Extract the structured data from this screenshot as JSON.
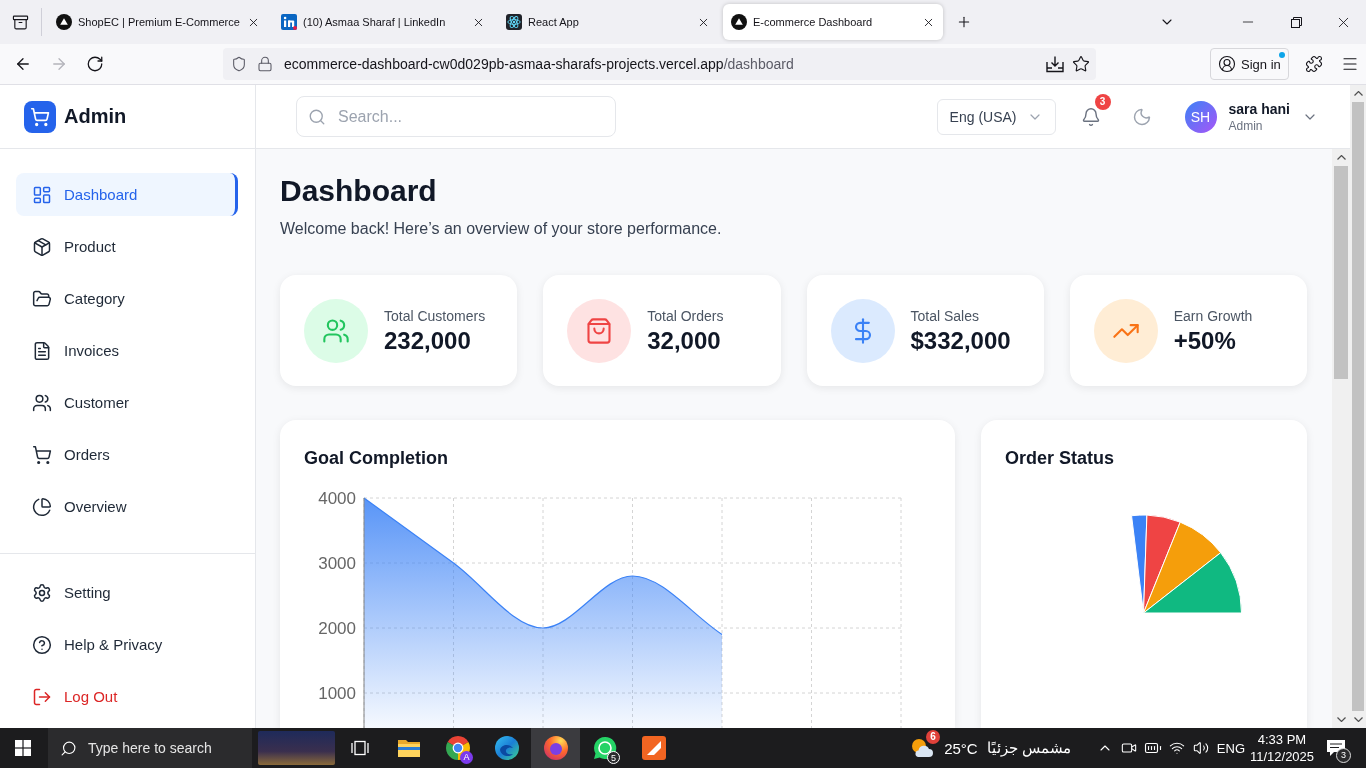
{
  "browser": {
    "tabs": [
      {
        "title": "ShopEC | Premium E-Commerce",
        "kind": "triangle",
        "selected": false
      },
      {
        "title": "(10) Asmaa Sharaf | LinkedIn",
        "kind": "blue-square",
        "selected": false
      },
      {
        "title": "React App",
        "kind": "atom",
        "selected": false
      },
      {
        "title": "E-commerce Dashboard",
        "kind": "triangle",
        "selected": true
      }
    ],
    "nav_buttons": [
      {
        "kind": "back",
        "disabled": false
      },
      {
        "kind": "forward",
        "disabled": true
      },
      {
        "kind": "reload",
        "disabled": false
      }
    ],
    "address": {
      "host": "ecommerce-dashboard-cw0d029pb-asmaa-sharafs-projects.vercel.app",
      "path": "/dashboard"
    },
    "sign_in": "Sign in"
  },
  "app": {
    "brand": "Admin",
    "search": {
      "placeholder": "Search..."
    },
    "language": "Eng (USA)",
    "notification_count": "3",
    "user": {
      "initials": "SH",
      "name": "sara hani",
      "role": "Admin"
    },
    "sidebar": {
      "items": [
        {
          "label": "Dashboard",
          "kind": "dashboard",
          "selected": true
        },
        {
          "label": "Product",
          "kind": "product",
          "selected": false
        },
        {
          "label": "Category",
          "kind": "category",
          "selected": false
        },
        {
          "label": "Invoices",
          "kind": "invoices",
          "selected": false
        },
        {
          "label": "Customer",
          "kind": "customer",
          "selected": false
        },
        {
          "label": "Orders",
          "kind": "orders",
          "selected": false
        },
        {
          "label": "Overview",
          "kind": "overview",
          "selected": false
        }
      ],
      "bottom_items": [
        {
          "label": "Setting",
          "kind": "settings",
          "selected": false
        },
        {
          "label": "Help & Privacy",
          "kind": "help",
          "selected": false
        },
        {
          "label": "Log Out",
          "kind": "logout",
          "selected": false
        }
      ]
    },
    "page": {
      "title": "Dashboard",
      "subtitle": "Welcome back! Here’s an overview of your store performance."
    },
    "stats": [
      {
        "label": "Total Customers",
        "value": "232,000",
        "kind": "customers"
      },
      {
        "label": "Total Orders",
        "value": "32,000",
        "kind": "orders"
      },
      {
        "label": "Total Sales",
        "value": "$332,000",
        "kind": "sales"
      },
      {
        "label": "Earn Growth",
        "value": "+50%",
        "kind": "growth"
      }
    ],
    "goal_completion": {
      "title": "Goal Completion",
      "chart_data": {
        "type": "area",
        "categories": [
          null,
          null,
          null,
          null,
          null,
          null,
          null
        ],
        "values": [
          4000,
          3000,
          2000,
          2800,
          1900,
          null,
          null
        ],
        "color": "#3b82f6",
        "ylim": [
          500,
          4000
        ],
        "yticks": [
          1000,
          2000,
          3000,
          4000
        ],
        "tick_labels": "y",
        "grid": true
      }
    },
    "order_status": {
      "title": "Order Status"
    }
  },
  "taskbar": {
    "search": {
      "placeholder": "Type here to search"
    },
    "apps": [
      {
        "kind": "folder",
        "selected": false
      },
      {
        "kind": "tricolor",
        "selected": false,
        "badge": "A"
      },
      {
        "kind": "wave",
        "selected": false
      },
      {
        "kind": "globe",
        "selected": true
      },
      {
        "kind": "chat",
        "selected": false,
        "badge": "5"
      },
      {
        "kind": "tile",
        "selected": false
      }
    ],
    "weather": {
      "badge": "6",
      "temperature": "25°C",
      "condition": "مشمس جزئيًا"
    },
    "language": "ENG",
    "time": "4:33 PM",
    "date": "11/12/2025",
    "notification_count": "3"
  }
}
